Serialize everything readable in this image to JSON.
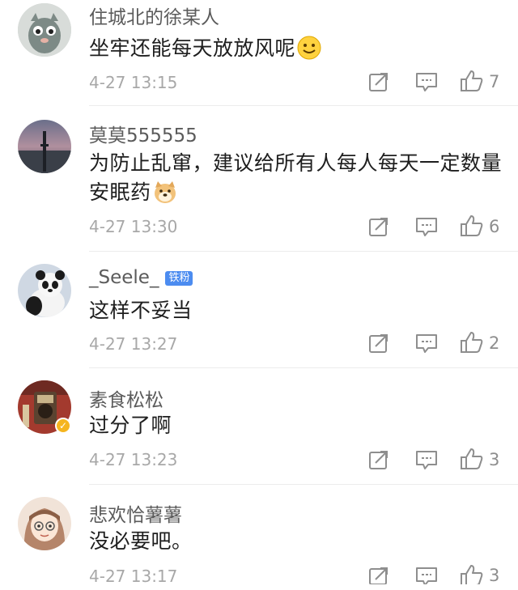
{
  "comments": [
    {
      "username": "住城北的徐某人",
      "text": "坐牢还能每天放放风呢",
      "emoji": "smile-emoji",
      "time": "4-27 13:15",
      "likes": "7",
      "badge": "",
      "verified": false
    },
    {
      "username": "莫莫555555",
      "text": "为防止乱窜，建议给所有人每人每天一定数量安眠药",
      "emoji": "doge-emoji",
      "time": "4-27 13:30",
      "likes": "6",
      "badge": "",
      "verified": false
    },
    {
      "username": "_Seele_",
      "text": "这样不妥当",
      "emoji": "",
      "time": "4-27 13:27",
      "likes": "2",
      "badge": "铁粉",
      "verified": false
    },
    {
      "username": "素食松松",
      "text": "过分了啊",
      "emoji": "",
      "time": "4-27 13:23",
      "likes": "3",
      "badge": "",
      "verified": true
    },
    {
      "username": "悲欢恰薯薯",
      "text": "没必要吧。",
      "emoji": "",
      "time": "4-27 13:17",
      "likes": "3",
      "badge": "",
      "verified": false
    }
  ],
  "icons": {
    "repost": "repost-icon",
    "reply": "comment-icon",
    "like": "thumbs-up-icon"
  },
  "colors": {
    "fan_badge": "#4c8cf0",
    "verified_badge": "#f5b51f",
    "meta_text": "#a8a8a8"
  }
}
